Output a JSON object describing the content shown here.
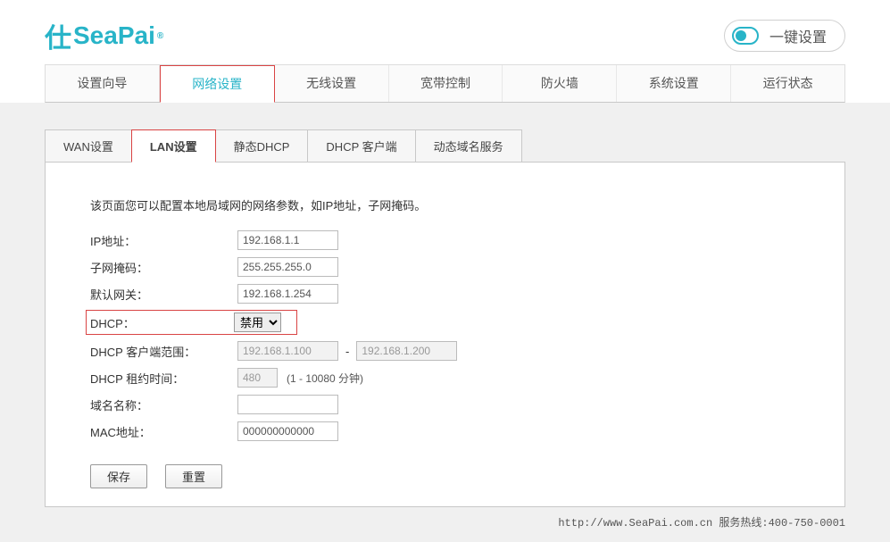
{
  "brand": {
    "icon_text": "仕",
    "name": "SeaPai",
    "reg": "®"
  },
  "quick_setup_label": "一键设置",
  "main_nav": [
    {
      "label": "设置向导"
    },
    {
      "label": "网络设置"
    },
    {
      "label": "无线设置"
    },
    {
      "label": "宽带控制"
    },
    {
      "label": "防火墙"
    },
    {
      "label": "系统设置"
    },
    {
      "label": "运行状态"
    }
  ],
  "sub_tabs": [
    {
      "label": "WAN设置"
    },
    {
      "label": "LAN设置"
    },
    {
      "label": "静态DHCP"
    },
    {
      "label": "DHCP 客户端"
    },
    {
      "label": "动态域名服务"
    }
  ],
  "panel": {
    "description": "该页面您可以配置本地局域网的网络参数，如IP地址，子网掩码。",
    "fields": {
      "ip_address_label": "IP地址：",
      "ip_address_value": "192.168.1.1",
      "subnet_mask_label": "子网掩码：",
      "subnet_mask_value": "255.255.255.0",
      "default_gateway_label": "默认网关：",
      "default_gateway_value": "192.168.1.254",
      "dhcp_label": "DHCP：",
      "dhcp_value": "禁用",
      "dhcp_range_label": "DHCP 客户端范围：",
      "dhcp_range_start": "192.168.1.100",
      "dhcp_range_dash": "-",
      "dhcp_range_end": "192.168.1.200",
      "dhcp_lease_label": "DHCP 租约时间：",
      "dhcp_lease_value": "480",
      "dhcp_lease_note": "(1 - 10080 分钟)",
      "domain_name_label": "域名名称：",
      "domain_name_value": "",
      "mac_address_label": "MAC地址：",
      "mac_address_value": "000000000000"
    },
    "buttons": {
      "save": "保存",
      "reset": "重置"
    }
  },
  "footer": {
    "url": "http://www.SeaPai.com.cn",
    "hotline_label": "服务热线:",
    "hotline_number": "400-750-0001"
  }
}
